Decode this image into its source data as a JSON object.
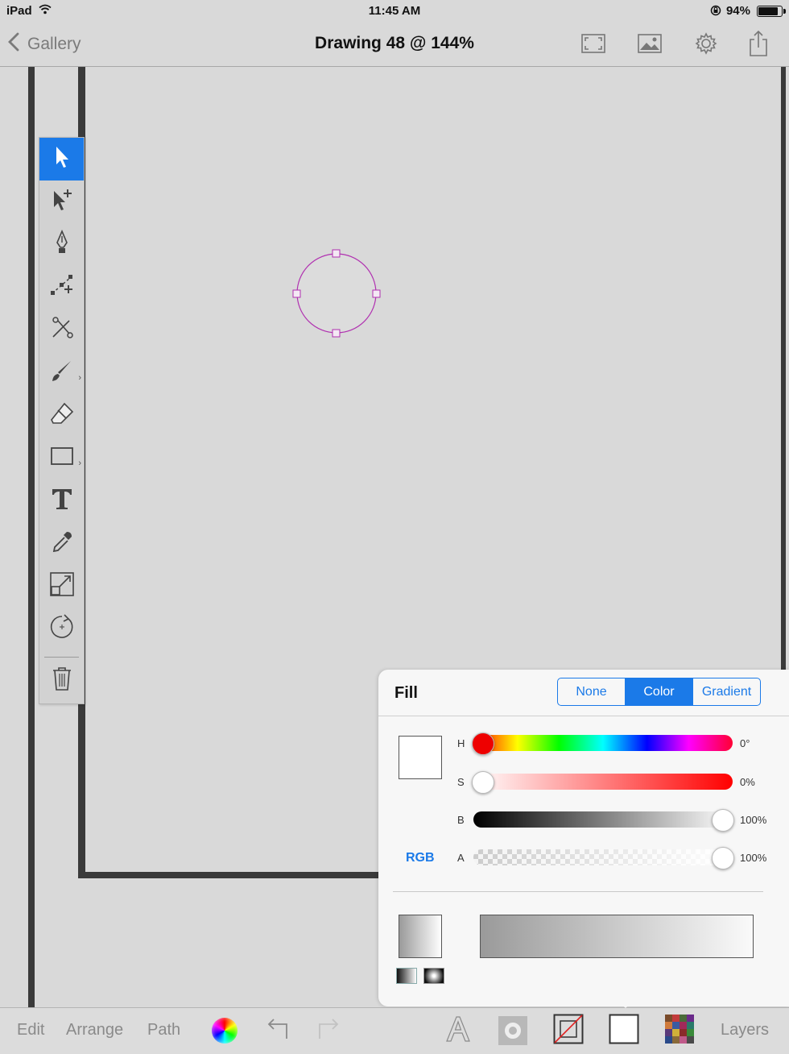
{
  "status_bar": {
    "device": "iPad",
    "time": "11:45 AM",
    "battery": "94%",
    "battery_level": 0.94
  },
  "nav": {
    "back_label": "Gallery",
    "title": "Drawing 48 @ 144%"
  },
  "fill_panel": {
    "title": "Fill",
    "segments": [
      "None",
      "Color",
      "Gradient"
    ],
    "selected_segment": "Color",
    "sliders": {
      "h": {
        "label": "H",
        "value": "0°",
        "fraction": 0.0
      },
      "s": {
        "label": "S",
        "value": "0%",
        "fraction": 0.0
      },
      "b": {
        "label": "B",
        "value": "100%",
        "fraction": 1.0
      },
      "a": {
        "label": "A",
        "value": "100%",
        "fraction": 1.0
      }
    },
    "mode_label": "RGB"
  },
  "bottom_bar": {
    "edit": "Edit",
    "arrange": "Arrange",
    "path": "Path",
    "layers": "Layers"
  },
  "colors": {
    "accent": "#1b7ae8",
    "selection": "#b030b0",
    "frame": "#3a3a3a"
  }
}
